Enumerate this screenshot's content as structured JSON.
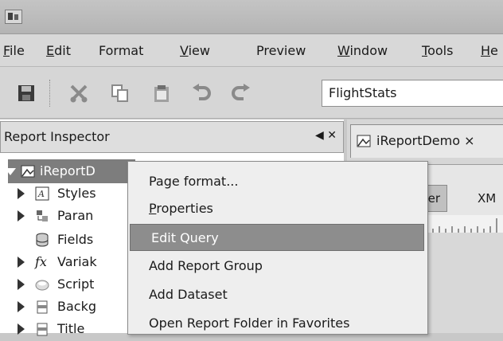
{
  "menubar": {
    "items": [
      {
        "label": "File",
        "mn": "F",
        "rest": "ile"
      },
      {
        "label": "Edit",
        "mn": "E",
        "rest": "dit"
      },
      {
        "label": "Format",
        "mn": "",
        "rest": "Format"
      },
      {
        "label": "View",
        "mn": "V",
        "rest": "iew"
      },
      {
        "label": "Preview",
        "mn": "",
        "rest": "Preview"
      },
      {
        "label": "Window",
        "mn": "W",
        "rest": "indow"
      },
      {
        "label": "Tools",
        "mn": "T",
        "rest": "ools"
      },
      {
        "label": "He",
        "mn": "H",
        "rest": "e"
      }
    ]
  },
  "toolbar": {
    "combo_value": "FlightStats",
    "icons": [
      "save-icon",
      "cut-icon",
      "copy-icon",
      "paste-icon",
      "undo-icon",
      "redo-icon"
    ]
  },
  "inspector": {
    "title": "Report Inspector",
    "controls": "◀ ✕",
    "tree": [
      {
        "label": "iReportD",
        "icon": "report-icon",
        "expanded": true
      },
      {
        "label": "Styles",
        "icon": "styles-icon"
      },
      {
        "label": "Paran",
        "icon": "parameters-icon"
      },
      {
        "label": "Fields",
        "icon": "fields-icon"
      },
      {
        "label": "Variak",
        "icon": "variables-icon"
      },
      {
        "label": "Script",
        "icon": "scriptlet-icon"
      },
      {
        "label": "Backg",
        "icon": "band-icon"
      },
      {
        "label": "Title",
        "icon": "band-icon"
      }
    ]
  },
  "editor": {
    "tab_label": "iReportDemo ×",
    "designer_label": "er",
    "xml_label": "XM"
  },
  "context_menu": {
    "items": [
      {
        "label": "Page format...",
        "mn": "",
        "rest": "Page format..."
      },
      {
        "label": "Properties",
        "mn": "P",
        "rest": "roperties"
      },
      {
        "label": "Edit Query",
        "mn": "",
        "rest": "Edit Query",
        "active": true
      },
      {
        "label": "Add Report Group",
        "mn": "",
        "rest": "Add Report Group"
      },
      {
        "label": "Add Dataset",
        "mn": "",
        "rest": "Add Dataset"
      },
      {
        "label": "Open Report Folder in Favorites",
        "mn": "",
        "rest": "Open Report Folder in Favorites"
      }
    ]
  }
}
